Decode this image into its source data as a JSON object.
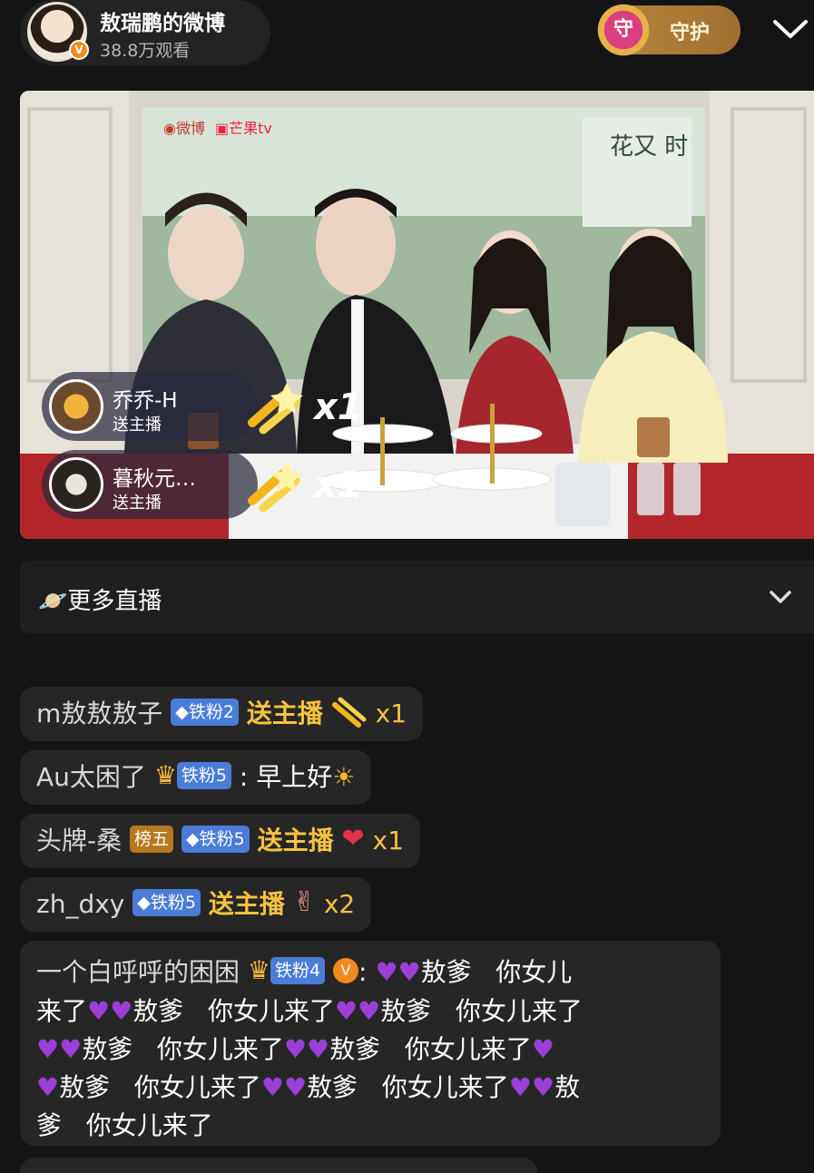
{
  "header": {
    "title": "敖瑞鹏的微博",
    "viewers": "38.8万观看",
    "guard_label": "守护",
    "guard_icon_char": "守"
  },
  "video": {
    "logos": [
      "微博",
      "芒果tv"
    ],
    "gifts": [
      {
        "name": "乔乔-H",
        "action": "送主播",
        "count": "x1",
        "icon": "firework-icon"
      },
      {
        "name": "暮秋元…",
        "action": "送主播",
        "count": "x1",
        "icon": "firework-icon"
      }
    ]
  },
  "more_live": {
    "label": "更多直播",
    "icon": "planet-icon"
  },
  "comments": [
    {
      "user": "m敖敖敖子",
      "badge": "铁粉2",
      "action": "送主播",
      "count": "x1",
      "gift_icon": "firework-icon"
    },
    {
      "user": "Au太困了",
      "badge": "铁粉5",
      "text": "早上好",
      "crown_icon": "crown-icon",
      "emoji": "sun-icon"
    },
    {
      "user": "头牌-桑",
      "rank": "榜五",
      "badge": "铁粉5",
      "action": "送主播",
      "count": "x1",
      "gift_icon": "heart-hands-icon"
    },
    {
      "user": "zh_dxy",
      "badge": "铁粉5",
      "action": "送主播",
      "count": "x2",
      "gift_icon": "finger-heart-icon"
    },
    {
      "user": "一个白呼呼的困困",
      "badge": "铁粉4",
      "segments": [
        "敖爹",
        "你女儿",
        "来了",
        "敖爹",
        "你女儿来了",
        "敖爹",
        "你女儿来了",
        "敖爹",
        "你女儿来了",
        "敖爹",
        "你女儿来了",
        "敖爹",
        "你女儿来了",
        "敖爹",
        "你女儿来了",
        "敖",
        "爹",
        "你女儿来了"
      ]
    }
  ],
  "colors": {
    "gold": "#f7c23f",
    "fan_badge": "#4a7cd8",
    "rank_badge": "#b6781f",
    "background": "#141414"
  }
}
